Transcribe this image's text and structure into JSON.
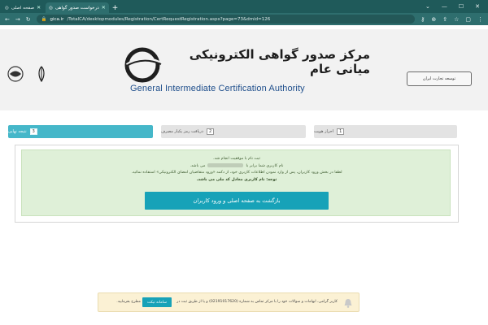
{
  "browser": {
    "tabs": [
      {
        "label": "صفحه اصلی"
      },
      {
        "label": "درخواست صدور گواهی"
      }
    ],
    "url_host": "gica.ir",
    "url_path": "/TotalCA/desktopmodules/Registration/CertRequestRegistration.aspx?page=73&dmid=126",
    "new_tab": "+"
  },
  "header": {
    "title_fa": "مرکز صدور گواهی الکترونیکی میانی عام",
    "title_en": "General Intermediate Certification Authority",
    "right_emblem_text": "توسعه تجارت ایران"
  },
  "steps": [
    {
      "num": "1",
      "label": "احراز هویت"
    },
    {
      "num": "2",
      "label": "دریافت رمز یکبار مصرف"
    },
    {
      "num": "3",
      "label": "نتیجه نهایی"
    }
  ],
  "result": {
    "line1": "ثبت نام با موفقیت انجام شد.",
    "line2_pre": "نام کاربری شما برابر با",
    "line2_post": "می باشد.",
    "line3": "لطفا در بخش ورود کاربران، پس از وارد نمودن اطلاعات کاربری خود، از دکمه «ورود متقاضیان امضای الکترونیکی» استفاده نمائید.",
    "line4": "توجه: نام کاربری معادل کد ملی می باشد.",
    "return_button": "بازگشت به صفحه اصلی و ورود کاربران"
  },
  "notice": {
    "text": "کاربر گرامی، ابهامات و سوالات خود را با مرکز تماس به شماره (02191017620) و یا از طریق ثبت در",
    "ticket_button": "سامانه تیکت",
    "tail": "مطرح بفرمایید."
  },
  "colors": {
    "accent": "#17a2b8",
    "success_bg": "#dff0d8",
    "chrome": "#2e6e6e"
  }
}
